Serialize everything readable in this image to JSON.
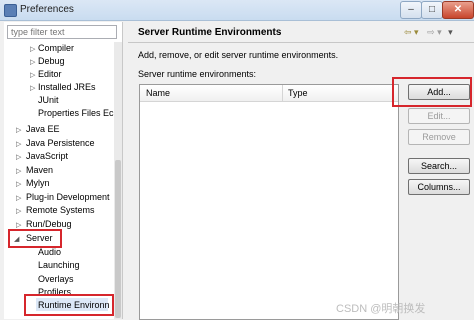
{
  "window": {
    "title": "Preferences",
    "minimize": "–",
    "maximize": "□",
    "close": "✕"
  },
  "filter": {
    "placeholder": "type filter text"
  },
  "tree": {
    "items": [
      {
        "label": "Compiler",
        "expander": "▷"
      },
      {
        "label": "Debug",
        "expander": "▷"
      },
      {
        "label": "Editor",
        "expander": "▷"
      },
      {
        "label": "Installed JREs",
        "expander": "▷"
      },
      {
        "label": "JUnit",
        "expander": ""
      },
      {
        "label": "Properties Files Ec",
        "expander": ""
      },
      {
        "label": "Java EE",
        "expander": "▷"
      },
      {
        "label": "Java Persistence",
        "expander": "▷"
      },
      {
        "label": "JavaScript",
        "expander": "▷"
      },
      {
        "label": "Maven",
        "expander": "▷"
      },
      {
        "label": "Mylyn",
        "expander": "▷"
      },
      {
        "label": "Plug-in Development",
        "expander": "▷"
      },
      {
        "label": "Remote Systems",
        "expander": "▷"
      },
      {
        "label": "Run/Debug",
        "expander": "▷"
      },
      {
        "label": "Server",
        "expander": "◢"
      },
      {
        "label": "Audio",
        "expander": ""
      },
      {
        "label": "Launching",
        "expander": ""
      },
      {
        "label": "Overlays",
        "expander": ""
      },
      {
        "label": "Profilers",
        "expander": ""
      },
      {
        "label": "Runtime Environn",
        "expander": ""
      }
    ]
  },
  "page": {
    "title": "Server Runtime Environments",
    "nav_back": "⇦ ▾",
    "nav_forward": "⇨ ▾",
    "menu": "▾",
    "description": "Add, remove, or edit server runtime environments.",
    "env_label": "Server runtime environments:",
    "columns": [
      "Name",
      "Type"
    ]
  },
  "buttons": {
    "add": "Add...",
    "edit": "Edit...",
    "remove": "Remove",
    "search": "Search...",
    "columns": "Columns..."
  },
  "watermark": "CSDN @明朝换发"
}
